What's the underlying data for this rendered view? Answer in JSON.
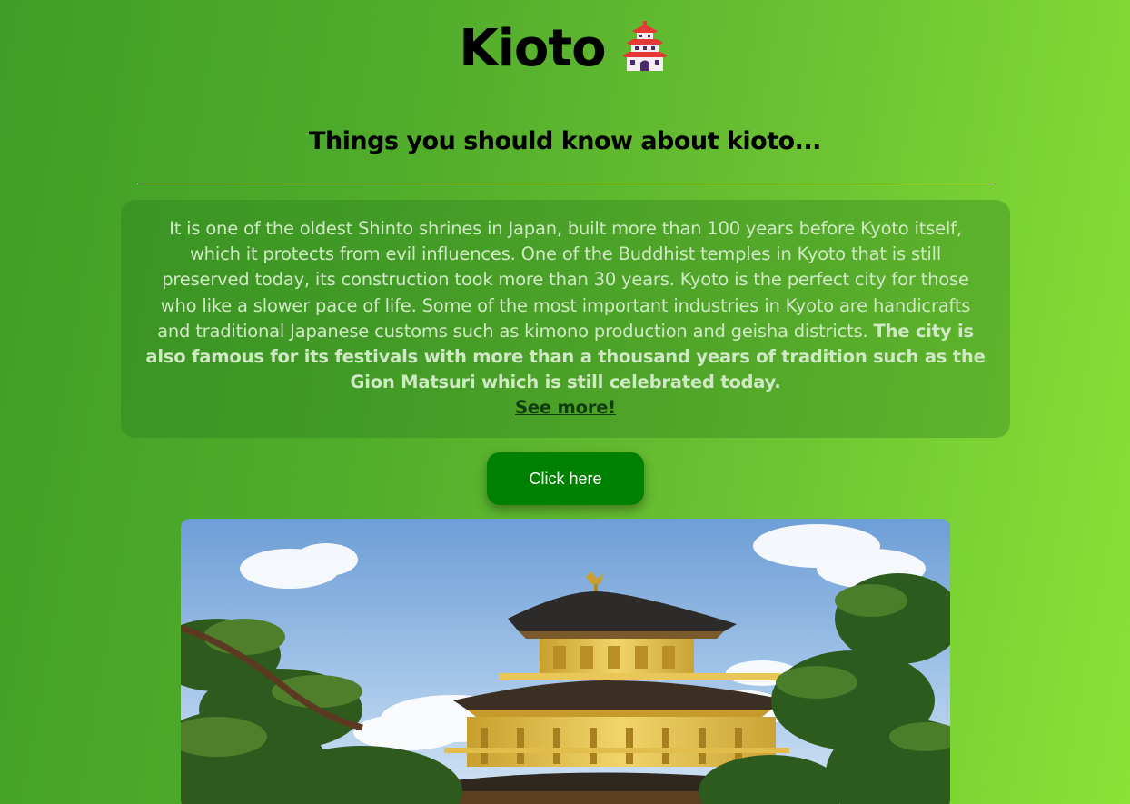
{
  "header": {
    "title": "Kioto",
    "title_icon": "japanese-castle-icon"
  },
  "intro": {
    "subtitle": "Things you should know about kioto..."
  },
  "info": {
    "text_regular": "It is one of the oldest Shinto shrines in Japan, built more than 100 years before Kyoto itself, which it protects from evil influences. One of the Buddhist temples in Kyoto that is still preserved today, its construction took more than 30 years. Kyoto is the perfect city for those who like a slower pace of life. Some of the most important industries in Kyoto are handicrafts and traditional Japanese customs such as kimono production and geisha districts.",
    "text_bold": "The city is also famous for its festivals with more than a thousand years of tradition such as the Gion Matsuri which is still celebrated today.",
    "link_label": "See more!"
  },
  "cta": {
    "button_label": "Click here"
  },
  "colors": {
    "background_start": "#3f9e26",
    "background_end": "#8ae236",
    "button": "#008000",
    "link": "#0f3d0c"
  }
}
